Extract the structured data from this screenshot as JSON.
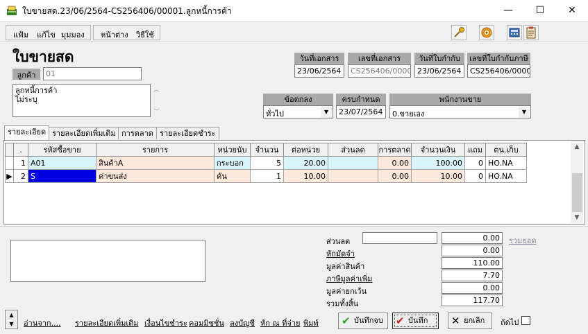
{
  "window": {
    "title": "ใบขายสด.23/06/2564-CS256406/00001.ลูกหนี้การค้า",
    "minimize": "—",
    "maximize": "☐",
    "close": "✕"
  },
  "menu": {
    "file": "แฟ้ม",
    "edit": "แก้ไข",
    "view": "มุมมอง",
    "window": "หน้าต่าง",
    "help": "วิธีใช้"
  },
  "header": {
    "doc_title": "ใบขายสด",
    "customer_label": "ลูกค้า",
    "customer_code": "01",
    "customer_name_line1": "ลูกหนี้การค้า",
    "customer_name_line2": "ไม่ระบุ",
    "doc_date_label": "วันที่เอกสาร",
    "doc_date": "23/06/2564",
    "doc_no_label": "เลขที่เอกสาร",
    "doc_no": "CS256406/00001",
    "tax_date_label": "วันที่ใบกำกับ",
    "tax_date": "23/06/2564",
    "tax_no_label": "เลขที่ใบกำกับภาษี",
    "tax_no": "CS256406/00001",
    "terms_label": "ข้อตกลง",
    "terms": "ทั่วไป",
    "due_label": "ครบกำหนด",
    "due_date": "23/07/2564",
    "salesperson_label": "พนักงานขาย",
    "salesperson": "0.ขายเอง"
  },
  "tabs": [
    {
      "label": "รายละเอียด"
    },
    {
      "label": "รายละเอียดเพิ่มเติม"
    },
    {
      "label": "การตลาด"
    },
    {
      "label": "รายละเอียดชำระ"
    }
  ],
  "grid": {
    "columns": [
      ".",
      "รหัสซื้อขาย",
      "รายการ",
      "หน่วยนับ",
      "จำนวน",
      "ต่อหน่วย",
      "ส่วนลด",
      "การตลาด",
      "จำนวนเงิน",
      "แถม",
      "ตน.เก็บ"
    ],
    "rows": [
      {
        "marker": "",
        "no": "1",
        "code": "A01",
        "name": "สินค้าA",
        "unit": "กระบอก",
        "qty": "5",
        "price": "20.00",
        "discount": "",
        "marketing": "0.00",
        "amount": "100.00",
        "free": "0",
        "store": "HO.NA"
      },
      {
        "marker": "▶",
        "no": "2",
        "code": "S",
        "name": "ค่าขนส่ง",
        "unit": "คัน",
        "qty": "1",
        "price": "10.00",
        "discount": "",
        "marketing": "0.00",
        "amount": "10.00",
        "free": "0",
        "store": "HO.NA"
      }
    ]
  },
  "summary": {
    "discount_label": "ส่วนลด",
    "discount": "0.00",
    "total_link": "รวมยอด",
    "deposit_label": "หักมัดจำ",
    "deposit": "0.00",
    "goods_value_label": "มูลค่าสินค้า",
    "goods_value": "110.00",
    "vat_label": "ภาษีมูลค่าเพิ่ม",
    "vat": "7.70",
    "exempt_label": "มูลค่ายกเว้น",
    "exempt": "0.00",
    "grand_total_label": "รวมทั้งสิ้น",
    "grand_total": "117.70"
  },
  "footer": {
    "read_from": "อ่านจาก....",
    "more_detail": "รายละเอียดเพิ่มเติม",
    "payment_terms": "เงื่อนไขชำระ",
    "commission": "คอมมิชชั่น",
    "post_account": "ลงบัญชี",
    "withholding": "หัก ณ ที่จ่าย",
    "print": "พิมพ์",
    "save_close": "บันทึกจบ",
    "save": "บันทึก",
    "cancel": "ยกเลิก",
    "next_label": "ถัดไป"
  },
  "colors": {
    "header_cell": "#a9a9a9",
    "cyan_cell": "#d9f5fb",
    "peach_cell": "#fde9dc",
    "selection": "#0000e0"
  }
}
